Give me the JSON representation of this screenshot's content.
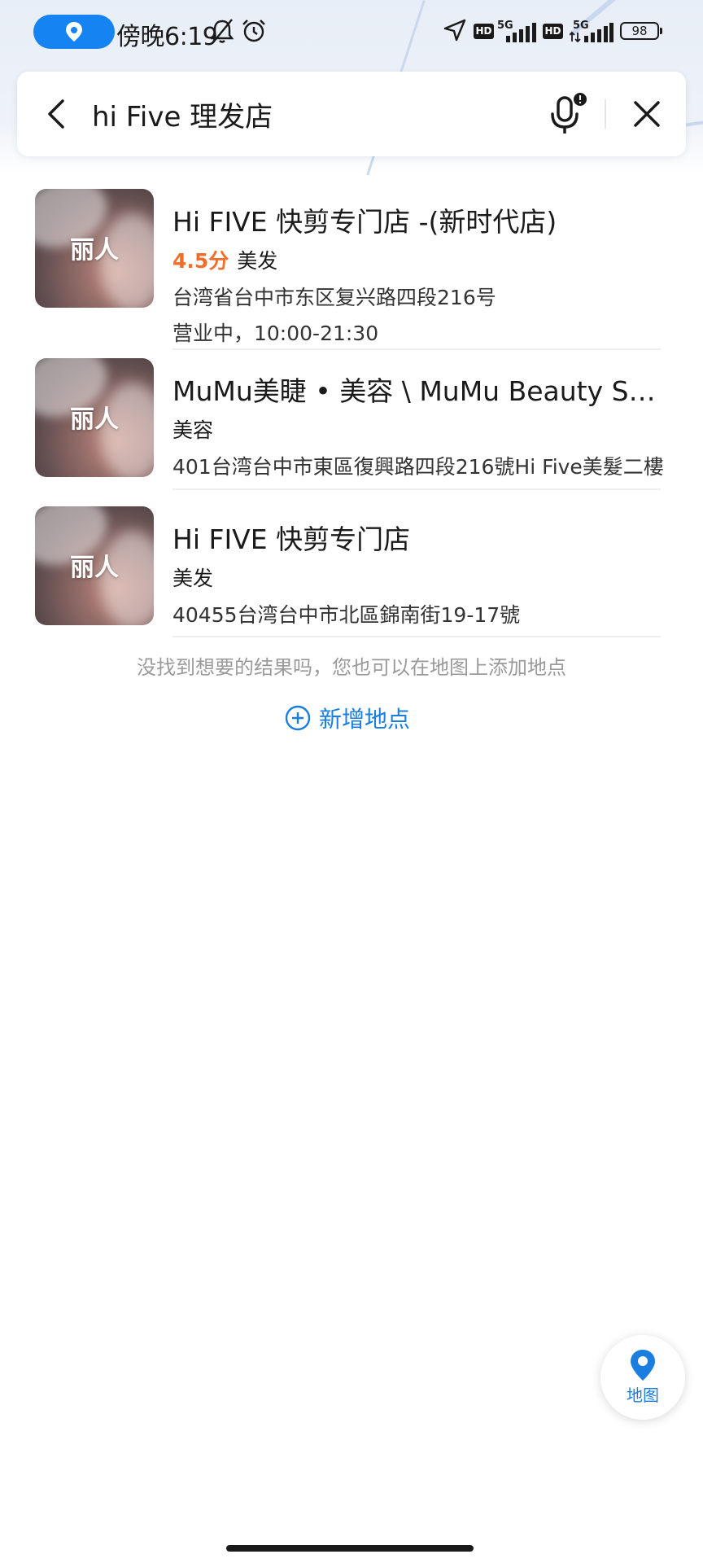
{
  "status_bar": {
    "time": "傍晚6:19",
    "network_left": "5G",
    "network_right": "5G",
    "hd_badge": "HD",
    "battery": "98"
  },
  "search": {
    "value": "hi Five 理发店",
    "back_icon": "chevron-left-icon",
    "mic_icon": "microphone-icon",
    "clear_icon": "close-icon"
  },
  "results": [
    {
      "thumb_label": "丽人",
      "title": "Hi FIVE 快剪专门店 -(新时代店)",
      "rating": "4.5分",
      "category": "美发",
      "address": "台湾省台中市东区复兴路四段216号",
      "hours": "营业中，10:00-21:30"
    },
    {
      "thumb_label": "丽人",
      "title": "MuMu美睫 • 美容 \\ MuMu Beauty Studio",
      "category": "美容",
      "address": "401台湾台中市東區復興路四段216號Hi Five美髮二樓"
    },
    {
      "thumb_label": "丽人",
      "title": "Hi FIVE 快剪专门店",
      "category": "美发",
      "address": "40455台湾台中市北區錦南街19-17號"
    }
  ],
  "hint": "没找到想要的结果吗，您也可以在地图上添加地点",
  "add_place": {
    "label": "新增地点",
    "icon": "plus-circle-icon"
  },
  "map_fab": {
    "label": "地图",
    "icon": "map-pin-icon"
  },
  "colors": {
    "accent": "#1a7de0",
    "rating": "#ef6e2c",
    "location_pill": "#1683f2"
  }
}
